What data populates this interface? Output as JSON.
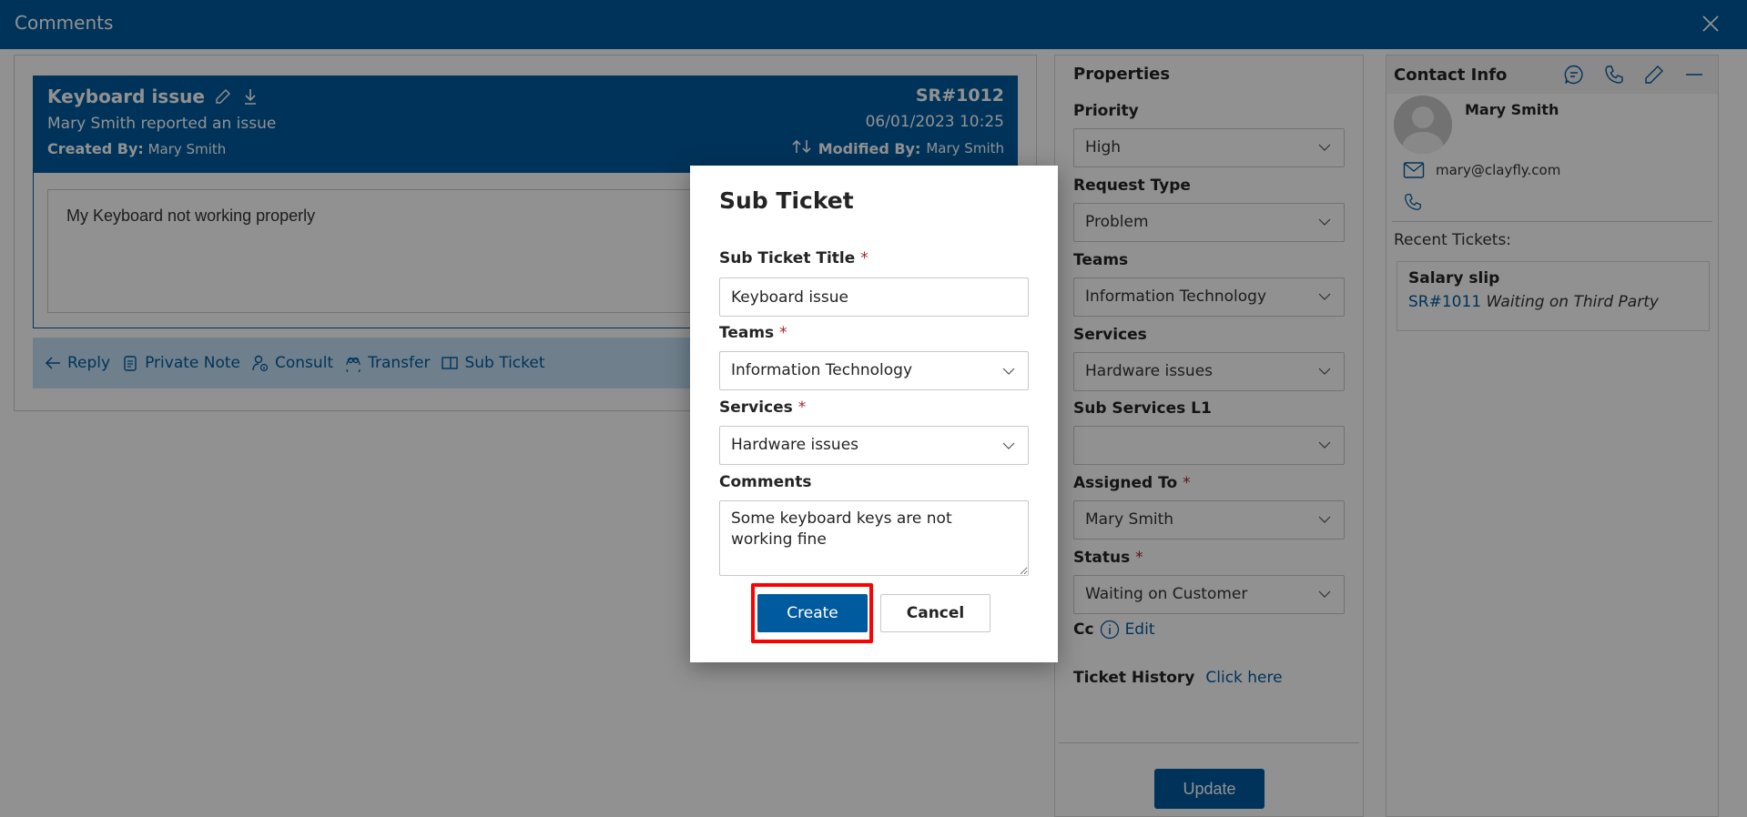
{
  "window": {
    "title": "Comments",
    "close_icon": "close-icon"
  },
  "ticket": {
    "title": "Keyboard issue",
    "subtitle": "Mary Smith reported an issue",
    "created_by_label": "Created By:",
    "created_by": "Mary Smith",
    "sr_number": "SR#1012",
    "datetime": "06/01/2023 10:25",
    "modified_by_label": "Modified By:",
    "modified_by": "Mary Smith",
    "body": "My Keyboard not working properly"
  },
  "actions": [
    {
      "label": "Reply",
      "icon": "arrow-left-icon"
    },
    {
      "label": "Private Note",
      "icon": "note-icon"
    },
    {
      "label": "Consult",
      "icon": "person-info-icon"
    },
    {
      "label": "Transfer",
      "icon": "people-transfer-icon"
    },
    {
      "label": "Sub Ticket",
      "icon": "split-view-icon"
    }
  ],
  "properties": {
    "title": "Properties",
    "fields": [
      {
        "label": "Priority",
        "value": "High",
        "required": false
      },
      {
        "label": "Request Type",
        "value": "Problem",
        "required": false
      },
      {
        "label": "Teams",
        "value": "Information Technology",
        "required": false
      },
      {
        "label": "Services",
        "value": "Hardware issues",
        "required": false
      },
      {
        "label": "Sub Services L1",
        "value": "",
        "required": false
      },
      {
        "label": "Assigned To",
        "value": "Mary Smith",
        "required": true
      },
      {
        "label": "Status",
        "value": "Waiting on Customer",
        "required": true
      }
    ],
    "required_mark": "*",
    "cc_label": "Cc",
    "cc_edit": "Edit",
    "history_label": "Ticket History",
    "history_link": "Click here",
    "update_label": "Update"
  },
  "contact": {
    "title": "Contact Info",
    "name": "Mary Smith",
    "email": "mary@clayfly.com",
    "recent_title": "Recent Tickets:",
    "recent_tickets": [
      {
        "title": "Salary slip",
        "sr": "SR#1011",
        "status": "Waiting on Third Party"
      }
    ]
  },
  "modal": {
    "title": "Sub Ticket",
    "title_label": "Sub Ticket Title",
    "title_value": "Keyboard issue",
    "teams_label": "Teams",
    "teams_value": "Information Technology",
    "services_label": "Services",
    "services_value": "Hardware issues",
    "comments_label": "Comments",
    "comments_value": "Some keyboard keys are not working fine",
    "required_mark": "*",
    "create_label": "Create",
    "cancel_label": "Cancel"
  },
  "colors": {
    "brand": "#005a9e",
    "highlight": "#ff0000",
    "required": "#a4262c"
  }
}
